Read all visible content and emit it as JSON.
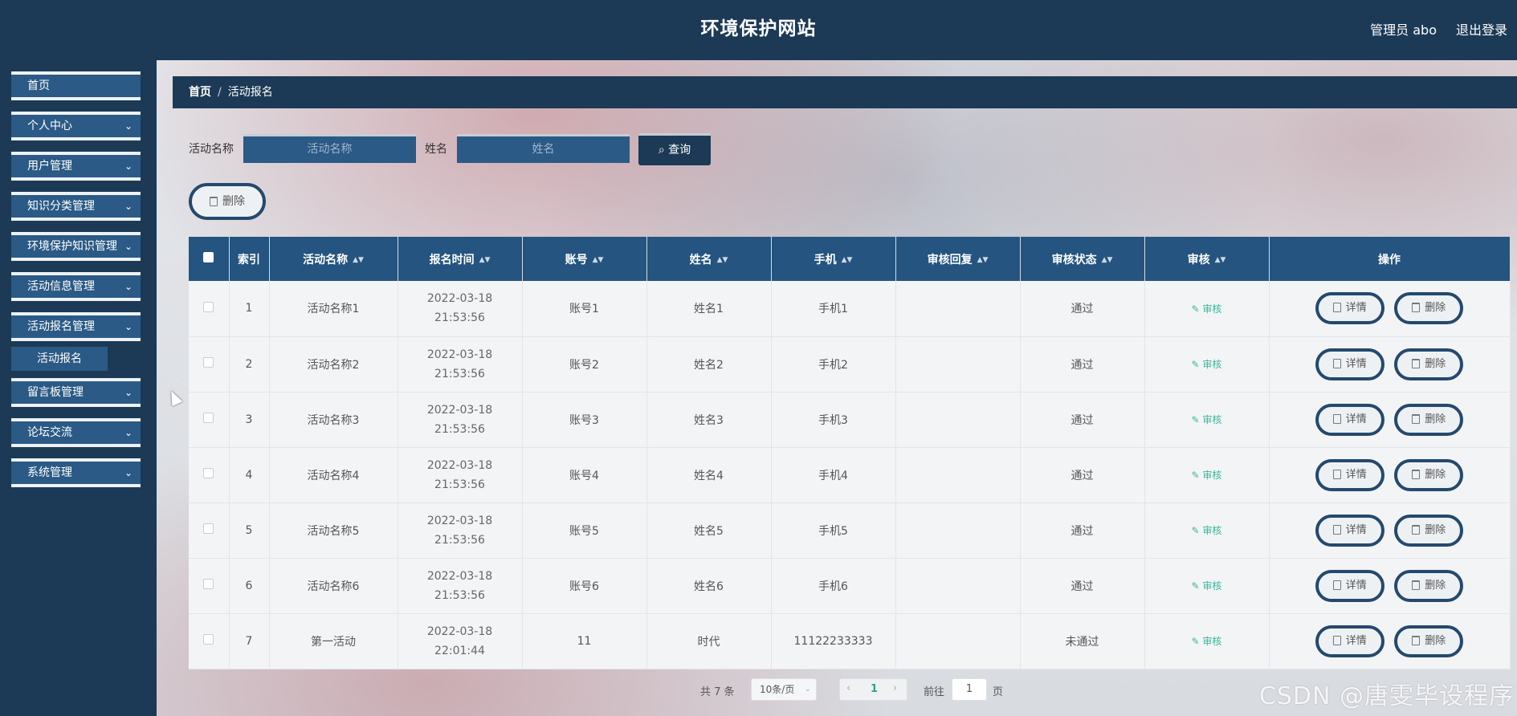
{
  "header": {
    "title": "环境保护网站",
    "user": "管理员 abo",
    "logout": "退出登录"
  },
  "sidebar": {
    "items": [
      {
        "label": "首页",
        "chevron": ""
      },
      {
        "label": "个人中心",
        "chevron": "⌄"
      },
      {
        "label": "用户管理",
        "chevron": "⌄"
      },
      {
        "label": "知识分类管理",
        "chevron": "⌄"
      },
      {
        "label": "环境保护知识管理",
        "chevron": "⌄"
      },
      {
        "label": "活动信息管理",
        "chevron": "⌄"
      },
      {
        "label": "活动报名管理",
        "chevron": "⌄"
      },
      {
        "label": "留言板管理",
        "chevron": "⌄"
      },
      {
        "label": "论坛交流",
        "chevron": "⌄"
      },
      {
        "label": "系统管理",
        "chevron": "⌄"
      }
    ],
    "sub_item": "活动报名"
  },
  "breadcrumb": {
    "home": "首页",
    "sep": "/",
    "current": "活动报名"
  },
  "search": {
    "activity_label": "活动名称",
    "activity_placeholder": "活动名称",
    "name_label": "姓名",
    "name_placeholder": "姓名",
    "query_label": "查询"
  },
  "toolbar": {
    "delete_label": "删除"
  },
  "table": {
    "headers": [
      "索引",
      "活动名称",
      "报名时间",
      "账号",
      "姓名",
      "手机",
      "审核回复",
      "审核状态",
      "审核",
      "操作"
    ],
    "sort_icon": "▲▼",
    "audit_label": "审核",
    "detail_label": "详情",
    "delete_label": "删除",
    "rows": [
      {
        "index": "1",
        "activity": "活动名称1",
        "time": "2022-03-18 21:53:56",
        "account": "账号1",
        "name": "姓名1",
        "phone": "手机1",
        "reply": "",
        "status": "通过"
      },
      {
        "index": "2",
        "activity": "活动名称2",
        "time": "2022-03-18 21:53:56",
        "account": "账号2",
        "name": "姓名2",
        "phone": "手机2",
        "reply": "",
        "status": "通过"
      },
      {
        "index": "3",
        "activity": "活动名称3",
        "time": "2022-03-18 21:53:56",
        "account": "账号3",
        "name": "姓名3",
        "phone": "手机3",
        "reply": "",
        "status": "通过"
      },
      {
        "index": "4",
        "activity": "活动名称4",
        "time": "2022-03-18 21:53:56",
        "account": "账号4",
        "name": "姓名4",
        "phone": "手机4",
        "reply": "",
        "status": "通过"
      },
      {
        "index": "5",
        "activity": "活动名称5",
        "time": "2022-03-18 21:53:56",
        "account": "账号5",
        "name": "姓名5",
        "phone": "手机5",
        "reply": "",
        "status": "通过"
      },
      {
        "index": "6",
        "activity": "活动名称6",
        "time": "2022-03-18 21:53:56",
        "account": "账号6",
        "name": "姓名6",
        "phone": "手机6",
        "reply": "",
        "status": "通过"
      },
      {
        "index": "7",
        "activity": "第一活动",
        "time": "2022-03-18 22:01:44",
        "account": "11",
        "name": "时代",
        "phone": "11122233333",
        "reply": "",
        "status": "未通过"
      }
    ]
  },
  "pagination": {
    "total": "共 7 条",
    "page_size": "10条/页",
    "current_page": "1",
    "goto_label": "前往",
    "goto_value": "1",
    "page_suffix": "页"
  },
  "watermark": "CSDN @唐雯毕设程序",
  "colors": {
    "header_bg": "#1c3a56",
    "menu_bg": "#2a5a85",
    "table_head": "#24547f",
    "audit_link": "#39b69c"
  },
  "icons": {
    "search": "search-icon",
    "delete": "trash-icon",
    "detail": "document-icon",
    "edit": "edit-icon"
  }
}
